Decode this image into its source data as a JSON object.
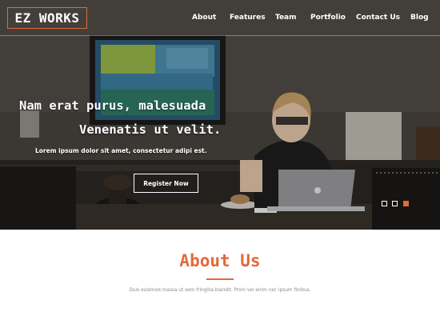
{
  "brand": {
    "logo_text": "EZ WORKS",
    "accent_color": "#e2693a"
  },
  "nav": {
    "items": [
      {
        "label": "About"
      },
      {
        "label": "Features"
      },
      {
        "label": "Team"
      },
      {
        "label": "Portfolio"
      },
      {
        "label": "Contact Us"
      },
      {
        "label": "Blog"
      }
    ]
  },
  "hero": {
    "headline_line1": "Nam erat purus, malesuada",
    "headline_line2": "Venenatis ut velit.",
    "subheadline": "Lorem ipsum dolor sit amet, consectetur adipi est.",
    "cta_label": "Register Now",
    "background_description_icon": "office-photo-background",
    "slider": {
      "total": 3,
      "active_index": 3
    }
  },
  "about": {
    "title": "About Us",
    "text": "Duis euismod massa ut sem fringilla blandit. Proin vel enim nec ipsum finibus."
  }
}
